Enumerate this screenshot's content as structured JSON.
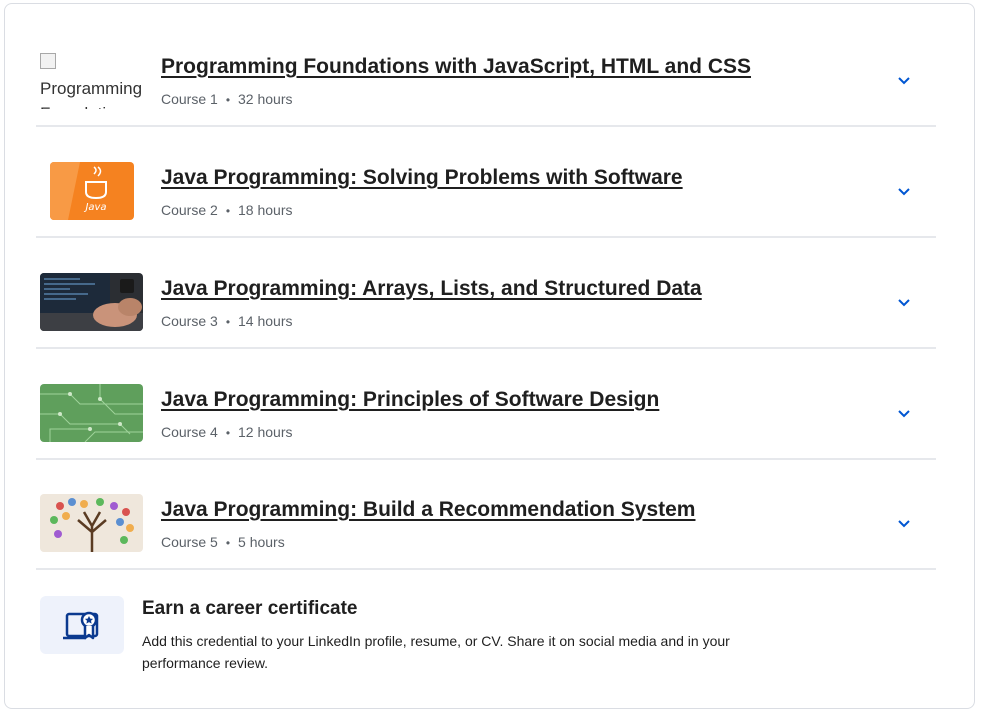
{
  "courses": [
    {
      "title": "Programming Foundations with JavaScript, HTML and CSS",
      "course_label": "Course 1",
      "duration": "32 hours",
      "thumb_alt": "Programming Foundations",
      "thumb": "broken-image"
    },
    {
      "title": "Java Programming: Solving Problems with Software",
      "course_label": "Course 2",
      "duration": "18 hours",
      "thumb": "java-logo"
    },
    {
      "title": "Java Programming: Arrays, Lists, and Structured Data",
      "course_label": "Course 3",
      "duration": "14 hours",
      "thumb": "laptop-typing"
    },
    {
      "title": "Java Programming: Principles of Software Design",
      "course_label": "Course 4",
      "duration": "12 hours",
      "thumb": "circuit-board"
    },
    {
      "title": "Java Programming: Build a Recommendation System",
      "course_label": "Course 5",
      "duration": "5 hours",
      "thumb": "idea-tree"
    }
  ],
  "certificate": {
    "title": "Earn a career certificate",
    "description": "Add this credential to your LinkedIn profile, resume, or CV. Share it on social media and in your performance review.",
    "icon": "certificate-icon"
  },
  "colors": {
    "accent": "#0056d2",
    "java_orange": "#f58220",
    "chevron": "#0056d2"
  }
}
